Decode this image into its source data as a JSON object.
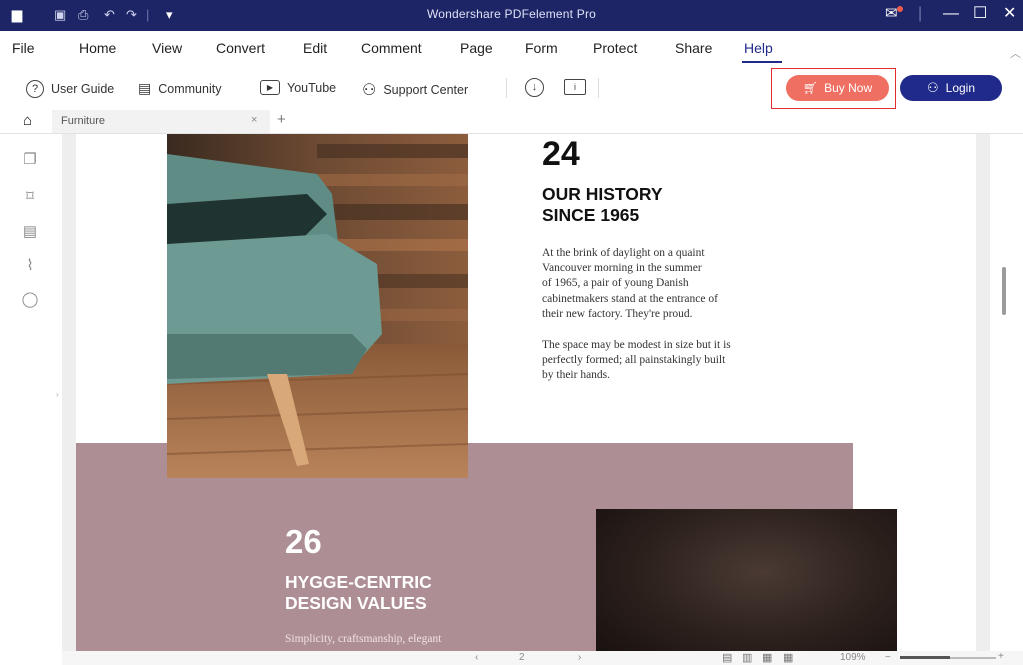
{
  "app": {
    "title": "Wondershare PDFelement Pro"
  },
  "menu": [
    "File",
    "Home",
    "View",
    "Convert",
    "Edit",
    "Comment",
    "Page",
    "Form",
    "Protect",
    "Share",
    "Help"
  ],
  "toolbar": {
    "user_guide": "User Guide",
    "community": "Community",
    "youtube": "YouTube",
    "support_center": "Support Center",
    "buy_now": "Buy Now",
    "login": "Login"
  },
  "tab": {
    "name": "Furniture",
    "close": "×",
    "add": "+"
  },
  "page": {
    "history_number": "24",
    "history_heading_1": "OUR HISTORY",
    "history_heading_2": "SINCE 1965",
    "history_para1": [
      "At the brink of daylight on a quaint",
      "Vancouver morning in the summer",
      "of 1965, a pair of young Danish",
      "cabinetmakers stand at the entrance of",
      "their new factory. They're proud."
    ],
    "history_para2": [
      "The space may be modest in size but it is",
      "perfectly formed; all painstakingly built",
      "by their hands."
    ],
    "values_number": "26",
    "values_heading_1": "HYGGE-CENTRIC",
    "values_heading_2": "DESIGN VALUES",
    "values_snippet": "Simplicity, craftsmanship, elegant"
  },
  "status": {
    "page": "2",
    "zoom": "109%"
  },
  "colors": {
    "titlebar": "#1d2566",
    "buy_now": "#ef6f62",
    "login": "#1f2a8a",
    "mauve": "#ad8e94",
    "highlight_box": "#e32b2b"
  }
}
